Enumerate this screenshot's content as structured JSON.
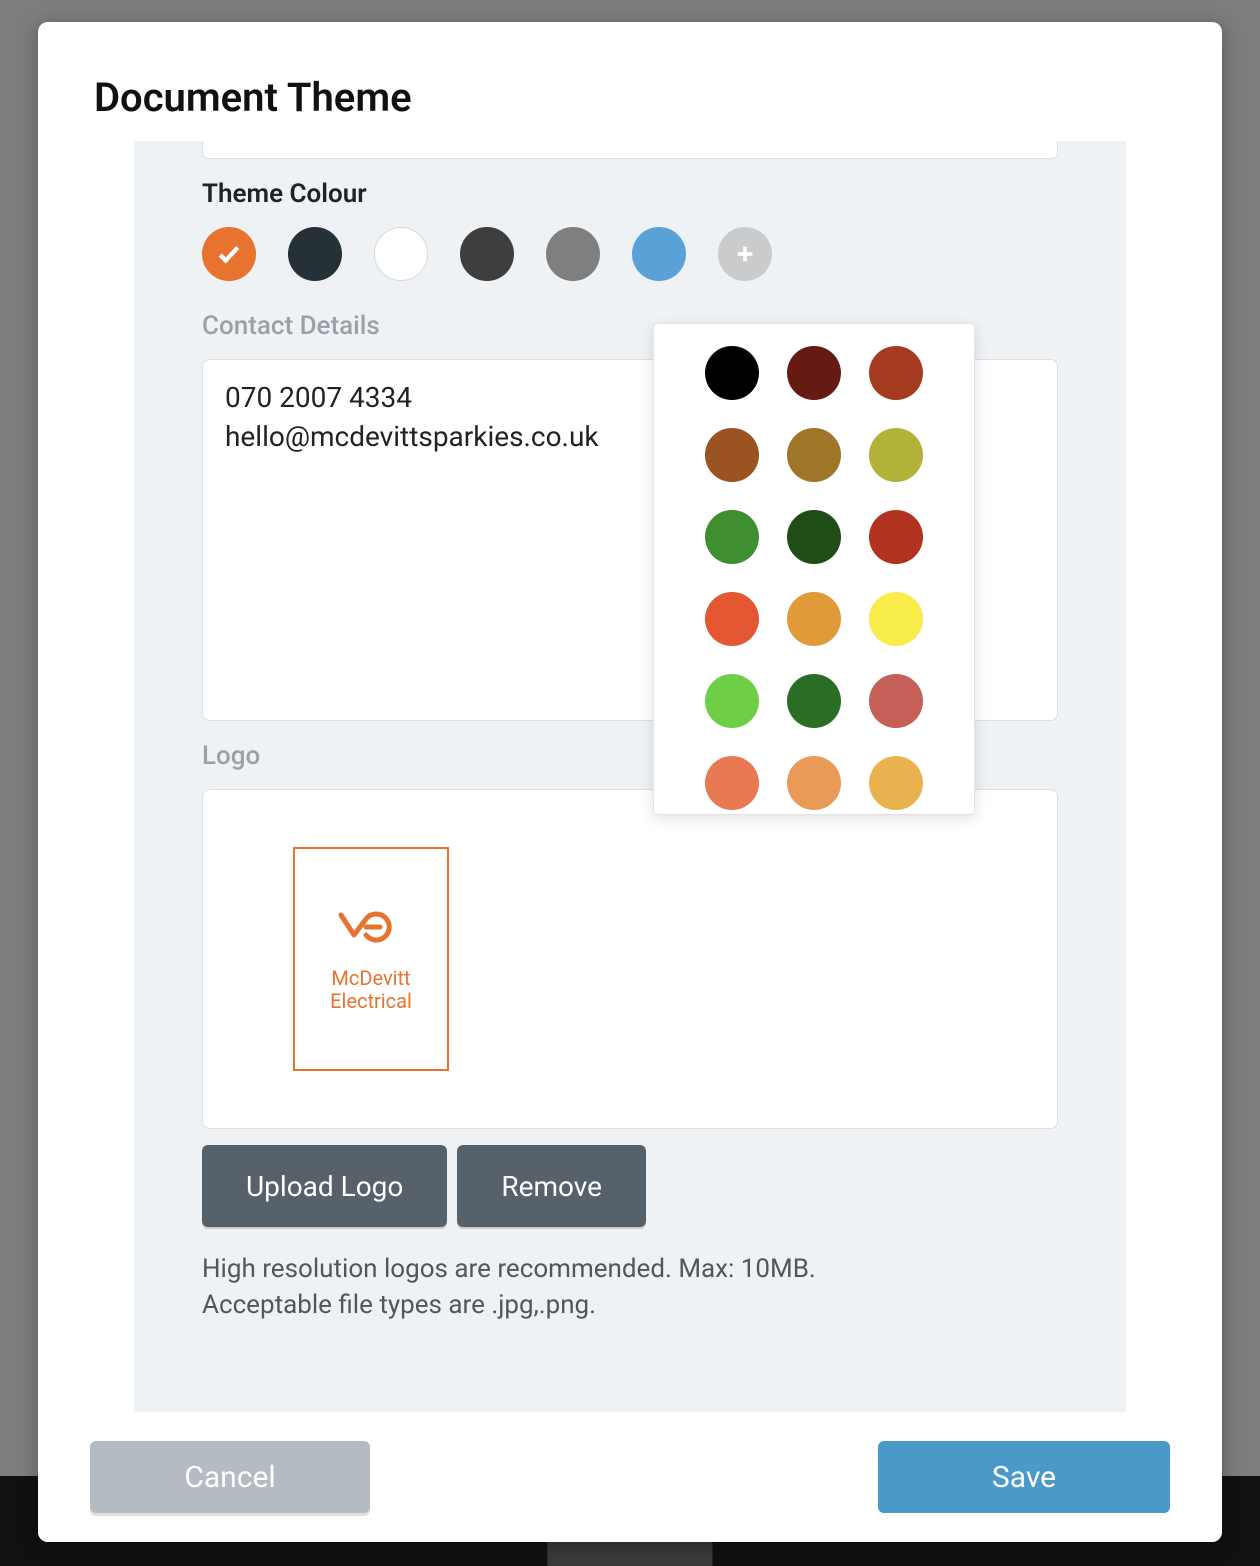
{
  "background_footer": {
    "cancel_label": "Cancel"
  },
  "modal": {
    "title": "Document Theme",
    "theme_colour": {
      "label": "Theme Colour",
      "swatches": [
        {
          "color": "#e8732f",
          "selected": true
        },
        {
          "color": "#253037"
        },
        {
          "color": "#ffffff",
          "white": true
        },
        {
          "color": "#3e3e3e"
        },
        {
          "color": "#7f7f7f"
        },
        {
          "color": "#5aa1d8"
        }
      ]
    },
    "contact": {
      "label": "Contact Details",
      "value": "070 2007 4334\nhello@mcdevittsparkies.co.uk"
    },
    "logo": {
      "label": "Logo",
      "company_name": "McDevitt\nElectrical",
      "accent": "#e8732f",
      "upload_label": "Upload Logo",
      "remove_label": "Remove",
      "hint_line1": "High resolution logos are recommended. Max: 10MB.",
      "hint_line2": "Acceptable file types are .jpg,.png."
    },
    "footer": {
      "cancel_label": "Cancel",
      "save_label": "Save"
    }
  },
  "color_picker": {
    "colors": [
      "#000000",
      "#651b14",
      "#a63a1e",
      "#9a5321",
      "#9f7528",
      "#b2b23a",
      "#3f8e2f",
      "#204c16",
      "#b3311f",
      "#e55633",
      "#e09a3a",
      "#f8ec4c",
      "#6ece46",
      "#2a6e25",
      "#c56058",
      "#e77a53",
      "#e89a56",
      "#e9b24e"
    ]
  }
}
